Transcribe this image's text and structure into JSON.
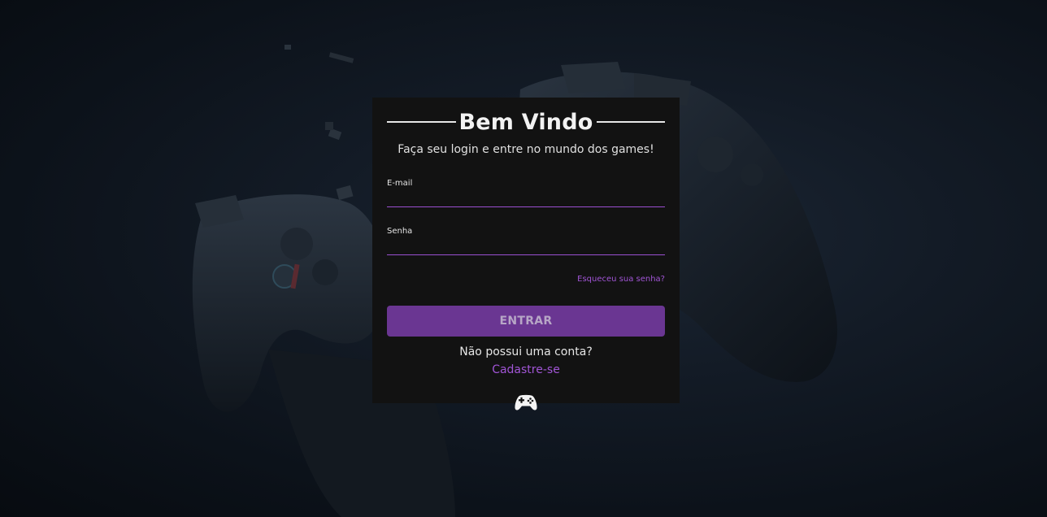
{
  "login": {
    "title": "Bem Vindo",
    "subtitle": "Faça seu login e entre no mundo dos games!",
    "email_label": "E-mail",
    "email_value": "",
    "password_label": "Senha",
    "password_value": "",
    "forgot_link": "Esqueceu sua senha?",
    "submit_label": "ENTRAR",
    "no_account_text": "Não possui uma conta?",
    "signup_link": "Cadastre-se"
  },
  "icons": {
    "footer_icon": "gamepad-icon",
    "background": "shattered-controller-art"
  },
  "colors": {
    "accent": "#a155d6",
    "button": "#6a3692",
    "card": "#121212",
    "background": "#0f1720"
  }
}
